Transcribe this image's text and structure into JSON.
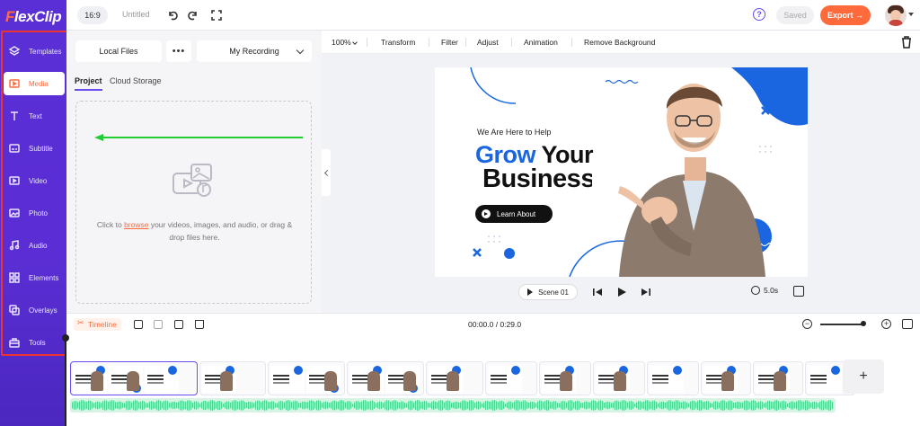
{
  "app": {
    "logo": "FlexClip"
  },
  "nav": {
    "items": [
      {
        "label": "Templates",
        "icon": "layers-icon"
      },
      {
        "label": "Media",
        "icon": "media-folder-icon",
        "active": true
      },
      {
        "label": "Text",
        "icon": "text-icon"
      },
      {
        "label": "Subtitle",
        "icon": "subtitle-icon"
      },
      {
        "label": "Video",
        "icon": "video-icon"
      },
      {
        "label": "Photo",
        "icon": "photo-icon"
      },
      {
        "label": "Audio",
        "icon": "music-note-icon"
      },
      {
        "label": "Elements",
        "icon": "elements-icon"
      },
      {
        "label": "Overlays",
        "icon": "overlays-icon"
      },
      {
        "label": "Tools",
        "icon": "toolbox-icon"
      }
    ]
  },
  "topbar": {
    "aspect_ratio": "16:9",
    "project_title": "Untitled",
    "help": "?",
    "saved_label": "Saved",
    "export_label": "Export →"
  },
  "media_panel": {
    "source_button": "Local Files",
    "more_button": "•••",
    "recording_select": "My Recording",
    "tabs": [
      "Project",
      "Cloud Storage"
    ],
    "drop_text_before": "Click to ",
    "drop_link": "browse",
    "drop_text_after": " your videos, images, and audio, or drag & drop files here."
  },
  "edit_toolbar": {
    "zoom": "100%",
    "items": [
      "Transform",
      "Filter",
      "Adjust",
      "Animation",
      "Remove Background"
    ]
  },
  "slide": {
    "subtitle": "We Are Here to Help",
    "headline_blue": "Grow",
    "headline_rest": " Your",
    "headline_line2": "Business",
    "button_label": "Learn About"
  },
  "playback": {
    "scene_label": "Scene 01",
    "duration": "5.0s"
  },
  "timeline": {
    "label": "Timeline",
    "timecode": "00:00.0 / 0:29.0",
    "add_clip": "+"
  },
  "colors": {
    "nav_bg": "#5a2ed4",
    "accent": "#ff6a3d",
    "brand_blue": "#1a66e0",
    "highlight_border": "#ee3333",
    "arrow_green": "#22cc33",
    "audio_wave": "#4fd494"
  }
}
